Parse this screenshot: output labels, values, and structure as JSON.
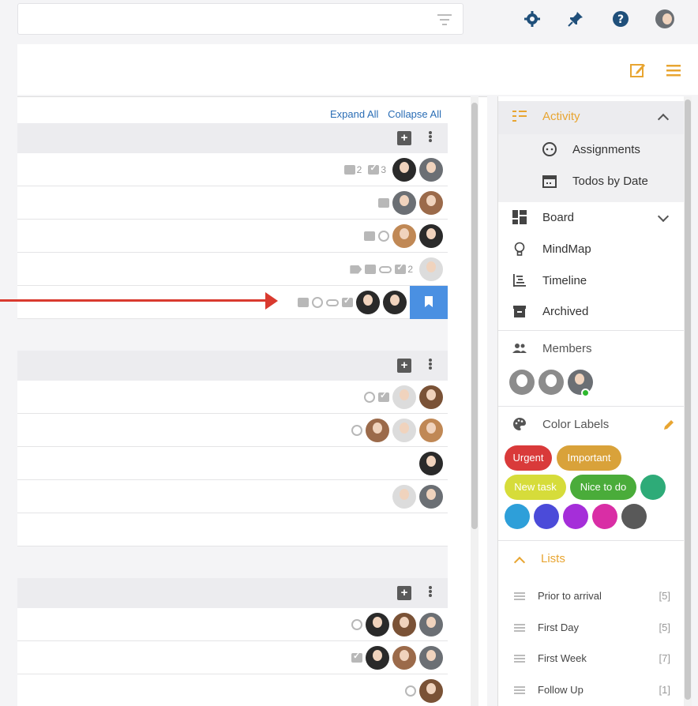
{
  "top_bar": {
    "icons": [
      "filter-icon",
      "gear-icon",
      "pin-icon",
      "help-icon",
      "user-avatar"
    ]
  },
  "sub_bar": {
    "icons": [
      "edit-icon",
      "menu-icon"
    ]
  },
  "board": {
    "expand_all": "Expand All",
    "collapse_all": "Collapse All",
    "groups": [
      {
        "rows": [
          {
            "comments": "2",
            "checks": "3"
          },
          {},
          {},
          {
            "checks": "2"
          },
          {}
        ]
      },
      {
        "rows": [
          {},
          {},
          {},
          {},
          {}
        ]
      },
      {
        "rows": [
          {},
          {},
          {}
        ]
      }
    ]
  },
  "panel": {
    "activity": "Activity",
    "assignments": "Assignments",
    "todos_by_date": "Todos by Date",
    "board": "Board",
    "mindmap": "MindMap",
    "timeline": "Timeline",
    "archived": "Archived",
    "members": "Members",
    "color_labels": "Color Labels",
    "labels": [
      {
        "name": "Urgent",
        "color": "#d93a3a"
      },
      {
        "name": "Important",
        "color": "#d9a23a"
      },
      {
        "name": "New task",
        "color": "#d6dc3a"
      },
      {
        "name": "Nice to do",
        "color": "#4aac3a"
      }
    ],
    "color_dots": [
      "#2eab78",
      "#2e9fd9",
      "#4b4bd9",
      "#a52ed9",
      "#d92ea5",
      "#595959"
    ],
    "lists_title": "Lists",
    "lists": [
      {
        "name": "Prior to arrival",
        "count": "[5]"
      },
      {
        "name": "First Day",
        "count": "[5]"
      },
      {
        "name": "First Week",
        "count": "[7]"
      },
      {
        "name": "Follow Up",
        "count": "[1]"
      }
    ]
  },
  "colors": {
    "accent": "#e8a531",
    "link": "#2a6db5",
    "bookmark": "#4a90e2",
    "arrow": "#d93a2f"
  }
}
